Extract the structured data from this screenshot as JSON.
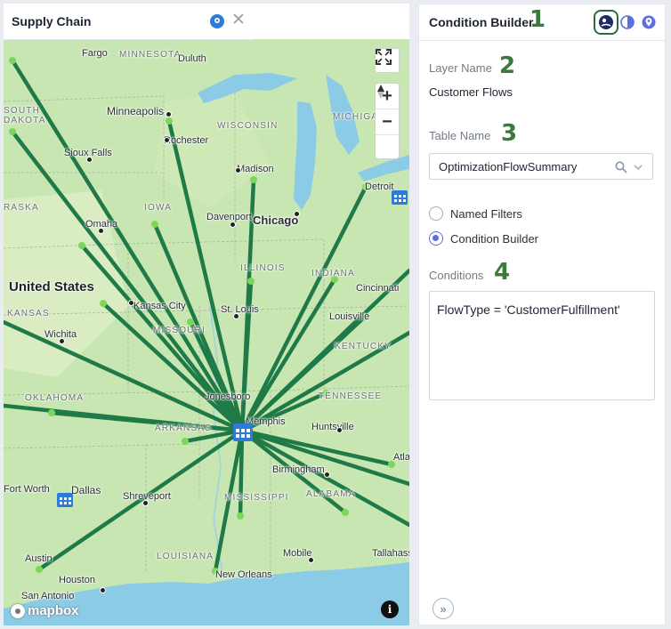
{
  "map_panel": {
    "tab_title": "Supply Chain",
    "labels": {
      "countries": [
        "United States"
      ],
      "states": [
        "MINNESOTA",
        "WISCONSIN",
        "MICHIGA",
        "SOUTH",
        "DAKOTA",
        "IOWA",
        "ILLINOIS",
        "INDIANA",
        "RASKA",
        "KANSAS",
        "MISSOURI",
        "KENTUCKY",
        "TENNESSEE",
        "OKLAHOMA",
        "ARKANSAS",
        "MISSISSIPPI",
        "ALABAMA",
        "LOUISIANA"
      ],
      "cities": [
        "Fargo",
        "Duluth",
        "Minneapolis",
        "Rochester",
        "Sioux Falls",
        "Madison",
        "Detroit",
        "Davenport",
        "Chicago",
        "Omaha",
        "Kansas City",
        "St. Louis",
        "Cincinnati",
        "Louisville",
        "Wichita",
        "Jonesboro",
        "Memphis",
        "Huntsville",
        "Birmingham",
        "Atla",
        "Fort Worth",
        "Dallas",
        "Shreveport",
        "Austin",
        "Houston",
        "San Antonio",
        "New Orleans",
        "Mobile",
        "Tallahass"
      ]
    },
    "attribution": "mapbox"
  },
  "condition_builder": {
    "title": "Condition Builder",
    "callouts": [
      "1",
      "2",
      "3",
      "4"
    ],
    "layer_name_label": "Layer Name",
    "layer_name_value": "Customer Flows",
    "table_name_label": "Table Name",
    "table_name_value": "OptimizationFlowSummary",
    "radio_options": [
      {
        "label": "Named Filters",
        "selected": false
      },
      {
        "label": "Condition Builder",
        "selected": true
      }
    ],
    "conditions_label": "Conditions",
    "conditions_value": "FlowType = 'CustomerFulfillment'"
  },
  "colors": {
    "flow_line": "#1f7a47",
    "flow_node": "#7cd65a",
    "water": "#8ccbe6",
    "land": "#c9e7b3",
    "accent": "#2d7bd6",
    "radio_selected": "#5a6fe0",
    "callout_number": "#3a7a3a"
  }
}
